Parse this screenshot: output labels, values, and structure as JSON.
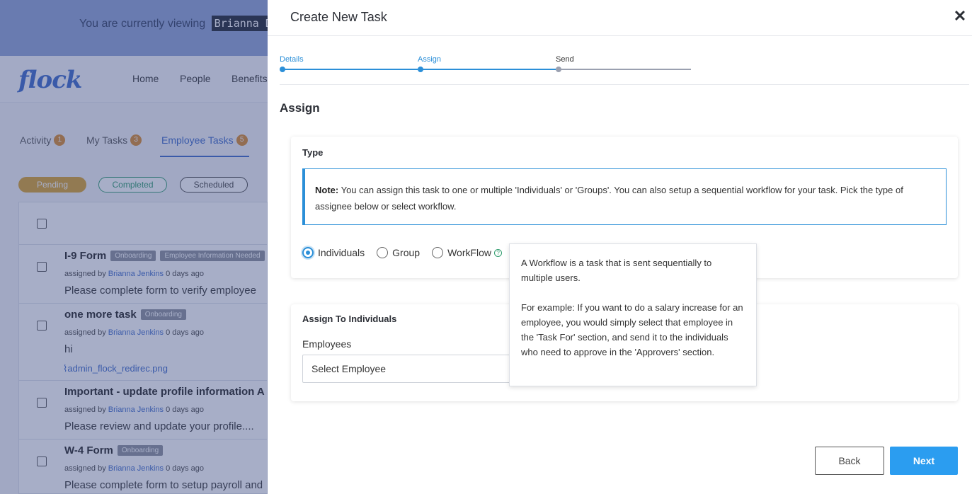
{
  "background": {
    "impersonation": {
      "prefix": "You are currently viewing",
      "name": "Brianna De"
    },
    "logo": "flock",
    "nav": [
      "Home",
      "People",
      "Benefits"
    ],
    "tabs": [
      {
        "label": "Activity",
        "count": "1"
      },
      {
        "label": "My Tasks",
        "count": "3"
      },
      {
        "label": "Employee Tasks",
        "count": "5"
      }
    ],
    "filters": [
      "Pending",
      "Completed",
      "Scheduled"
    ],
    "tasks": [
      {
        "title": "I-9 Form",
        "tags": [
          "Onboarding",
          "Employee Information Needed"
        ],
        "assigned_prefix": "assigned by",
        "assigned_by": "Brianna Jenkins",
        "when": "0 days ago",
        "desc": "Please complete form to verify employee",
        "attachment": ""
      },
      {
        "title": "one more task",
        "tags": [
          "Onboarding"
        ],
        "assigned_prefix": "assigned by",
        "assigned_by": "Brianna Jenkins",
        "when": "0 days ago",
        "desc": "hi",
        "attachment": "admin_flock_redirec.png"
      },
      {
        "title": "Important - update profile information A",
        "tags": [],
        "assigned_prefix": "assigned by",
        "assigned_by": "Brianna Jenkins",
        "when": "0 days ago",
        "desc": "Please review and update your profile....",
        "attachment": ""
      },
      {
        "title": "W-4 Form",
        "tags": [
          "Onboarding"
        ],
        "assigned_prefix": "assigned by",
        "assigned_by": "Brianna Jenkins",
        "when": "0 days ago",
        "desc": "Please complete form to setup payroll and",
        "attachment": ""
      }
    ]
  },
  "modal": {
    "title": "Create New Task",
    "close_glyph": "✕",
    "steps": [
      {
        "label": "Details",
        "state": "done"
      },
      {
        "label": "Assign",
        "state": "active"
      },
      {
        "label": "Send",
        "state": "pending"
      }
    ],
    "section_title": "Assign",
    "type_card": {
      "label": "Type",
      "note_bold": "Note:",
      "note_text": " You can assign this task to one or multiple 'Individuals' or 'Groups'. You can also setup a sequential workflow for your task. Pick the type of assignee below or select workflow.",
      "options": [
        "Individuals",
        "Group",
        "WorkFlow"
      ],
      "selected": "Individuals",
      "help_glyph": "?"
    },
    "assign_card": {
      "label": "Assign To Individuals",
      "field_label": "Employees",
      "select_placeholder": "Select Employee"
    },
    "tooltip": {
      "para1": "A Workflow is a task that is sent sequentially to multiple users.",
      "para2": "For example: If you want to do a salary increase for an employee, you would simply select that employee in the 'Task For' section, and send it to the individuals who need to approve in the 'Approvers' section."
    },
    "buttons": {
      "back": "Back",
      "next": "Next"
    },
    "colors": {
      "accent": "#2b8fd8",
      "primary_button": "#2b9df0",
      "step_active": "#2b8fd8",
      "step_pending": "#9aa0b0"
    }
  }
}
